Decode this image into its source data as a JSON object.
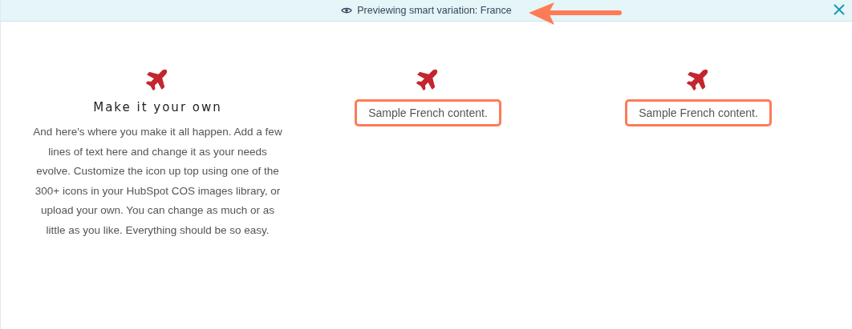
{
  "banner": {
    "text": "Previewing smart variation: France",
    "annotated": true
  },
  "columns": [
    {
      "kind": "feature",
      "heading": "Make it your own",
      "body": "And here's where you make it all happen. Add a few lines of text here and change it as your needs evolve. Customize the icon up top using one of the 300+ icons in your HubSpot COS images library, or upload your own. You can change as much or as little as you like. Everything should be so easy."
    },
    {
      "kind": "sample",
      "body": "Sample French content.",
      "highlighted": true
    },
    {
      "kind": "sample",
      "body": "Sample French content.",
      "highlighted": true
    }
  ]
}
